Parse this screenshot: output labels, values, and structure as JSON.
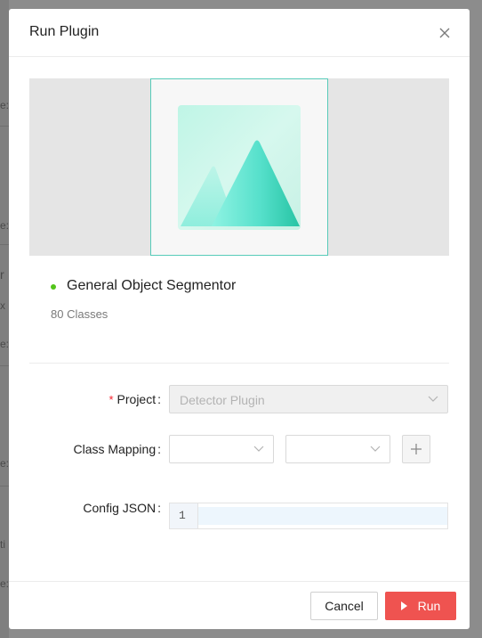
{
  "modal": {
    "title": "Run Plugin"
  },
  "plugin": {
    "name": "General Object Segmentor",
    "classes": "80 Classes",
    "status_color": "#52c41a"
  },
  "form": {
    "project_label": "Project",
    "project_value": "Detector Plugin",
    "class_mapping_label": "Class Mapping",
    "class_mapping_source": "",
    "class_mapping_target": "",
    "config_label": "Config JSON",
    "config_line_number": "1",
    "config_value": ""
  },
  "footer": {
    "cancel_label": "Cancel",
    "run_label": "Run",
    "run_color": "#ef5350"
  },
  "background": {
    "fragments": [
      "e:",
      "e:",
      "r",
      "x",
      "e:",
      "e:",
      "ti",
      "e:"
    ]
  },
  "icons": {
    "close": "close-icon",
    "preview": "mountain-image-icon",
    "chevron": "chevron-down-icon",
    "plus": "plus-icon",
    "play": "play-icon"
  }
}
